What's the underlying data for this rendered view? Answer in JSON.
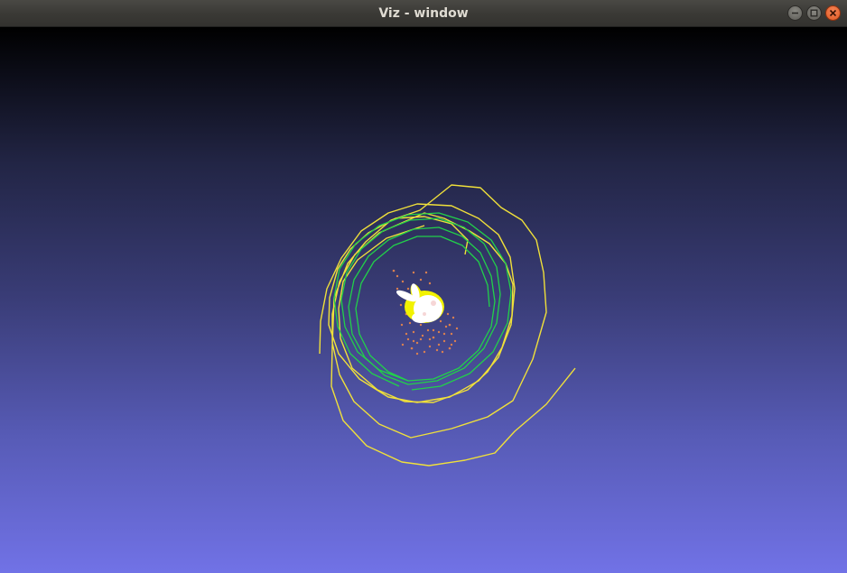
{
  "window": {
    "title": "Viz - window",
    "controls": {
      "minimize_icon": "minimize-icon",
      "maximize_icon": "maximize-icon",
      "close_icon": "close-icon"
    }
  },
  "viewport": {
    "background_top": "#000000",
    "background_bottom": "#7172e6"
  },
  "scene": {
    "trajectory_color": "#f0e03a",
    "camera_path_color": "#22d04a",
    "object_color": "#ffffff",
    "object_highlight_color": "#f2f200",
    "point_cloud_color": "#d98050"
  }
}
